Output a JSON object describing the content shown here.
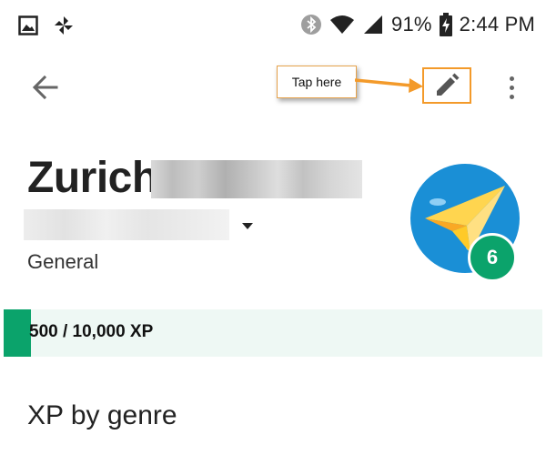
{
  "status_bar": {
    "battery": "91%",
    "time": "2:44 PM",
    "icons": [
      "gallery-icon",
      "pinwheel-icon",
      "bluetooth-icon",
      "wifi-icon",
      "signal-icon",
      "battery-charging-icon"
    ]
  },
  "toolbar": {
    "back_icon": "arrow-left-icon",
    "edit_icon": "pencil-icon",
    "more_icon": "more-vert-icon"
  },
  "callout": {
    "text": "Tap here",
    "color": "#f39a2a"
  },
  "profile": {
    "name": "Zurich",
    "category": "General",
    "level": "6",
    "avatar_icon": "paper-plane-icon"
  },
  "xp": {
    "label": "500 / 10,000 XP",
    "current": 500,
    "max": 10000,
    "fill_color": "#0ba36b"
  },
  "section": {
    "title": "XP by genre"
  }
}
